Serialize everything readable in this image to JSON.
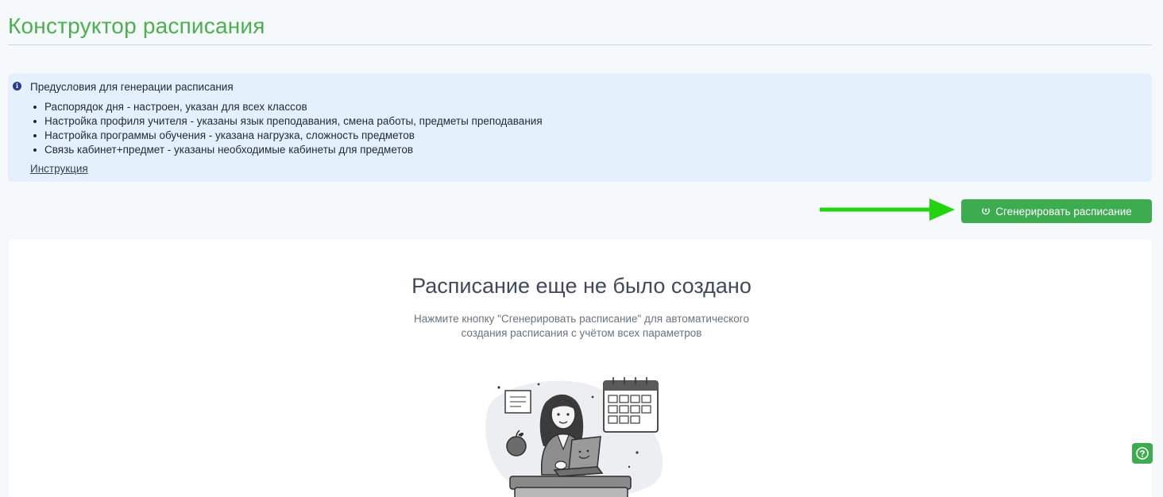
{
  "page": {
    "title": "Конструктор расписания"
  },
  "info": {
    "heading": "Предусловия для генерации расписания",
    "items": [
      "Распорядок дня - настроен, указан для всех классов",
      "Настройка профиля учителя - указаны язык преподавания, смена работы, предметы преподавания",
      "Настройка программы обучения - указана нагрузка, сложность предметов",
      "Связь кабинет+предмет - указаны необходимые кабинеты для предметов"
    ],
    "link_label": "Инструкция"
  },
  "actions": {
    "generate_label": "Сгенерировать расписание"
  },
  "empty_state": {
    "title": "Расписание еще не было создано",
    "text_line1": "Нажмите кнопку \"Сгенерировать расписание\" для автоматического",
    "text_line2": "создания расписания с учётом всех параметров"
  },
  "icons": {
    "info": "info-icon",
    "generate": "refresh-icon",
    "help": "help-icon"
  },
  "colors": {
    "accent": "#3dab4f",
    "title": "#4caf50",
    "info_bg": "#e4f0fb",
    "arrow": "#22d30f"
  }
}
